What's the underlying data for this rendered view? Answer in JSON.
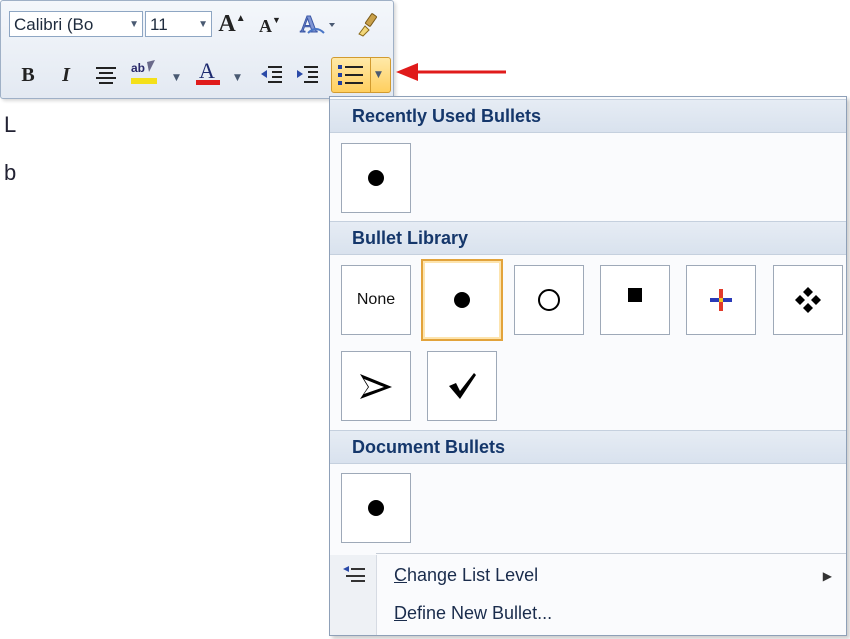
{
  "toolbar": {
    "font_name": "Calibri (Bo",
    "font_size": "11",
    "grow_font_label": "A",
    "shrink_font_label": "A",
    "bold_label": "B",
    "italic_label": "I",
    "font_color_label": "A",
    "highlight_color": "#f4e01a",
    "font_color": "#e01b1b"
  },
  "document": {
    "glyph1": "L",
    "glyph2": "b"
  },
  "gallery": {
    "recent_header": "Recently Used Bullets",
    "library_header": "Bullet Library",
    "document_header": "Document Bullets",
    "none_label": "None",
    "library_items": [
      "none",
      "filled-circle",
      "hollow-circle",
      "filled-square",
      "colored-cross",
      "four-diamonds",
      "arrowhead",
      "checkmark"
    ],
    "selected_item": "filled-circle"
  },
  "menu": {
    "change_level_prefix": "C",
    "change_level_rest": "hange List Level",
    "define_prefix": "D",
    "define_rest": "efine New Bullet..."
  },
  "annotation": {
    "arrow_color": "#e01b1b"
  }
}
